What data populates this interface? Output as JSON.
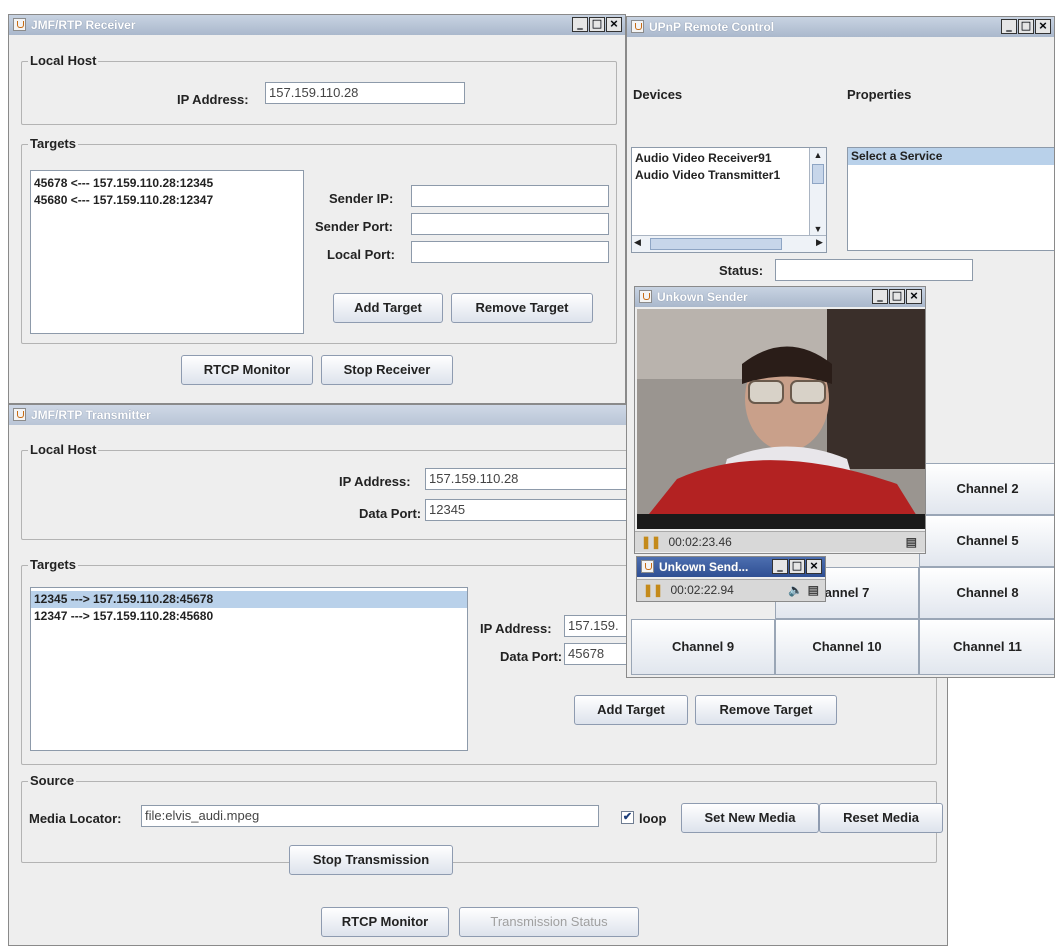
{
  "receiver": {
    "title": "JMF/RTP Receiver",
    "local_host_label": "Local Host",
    "ip_label": "IP Address:",
    "ip_value": "157.159.110.28",
    "targets_label": "Targets",
    "targets": [
      "45678 <--- 157.159.110.28:12345",
      "45680 <--- 157.159.110.28:12347"
    ],
    "sender_ip_label": "Sender IP:",
    "sender_port_label": "Sender Port:",
    "local_port_label": "Local Port:",
    "add_target": "Add Target",
    "remove_target": "Remove Target",
    "rtcp_monitor": "RTCP Monitor",
    "stop_receiver": "Stop Receiver"
  },
  "transmitter": {
    "title": "JMF/RTP Transmitter",
    "local_host_label": "Local Host",
    "ip_label": "IP Address:",
    "ip_value": "157.159.110.28",
    "data_port_label": "Data Port:",
    "data_port_value": "12345",
    "targets_label": "Targets",
    "targets": [
      "12345 ---> 157.159.110.28:45678",
      "12347 ---> 157.159.110.28:45680"
    ],
    "target_ip_label": "IP Address:",
    "target_ip_value": "157.159.",
    "target_port_label": "Data Port:",
    "target_port_value": "45678",
    "add_target": "Add Target",
    "remove_target": "Remove Target",
    "source_label": "Source",
    "media_locator_label": "Media Locator:",
    "media_locator_value": "file:elvis_audi.mpeg",
    "loop_label": "loop",
    "loop_checked": true,
    "set_new_media": "Set New Media",
    "reset_media": "Reset Media",
    "stop_transmission": "Stop Transmission",
    "rtcp_monitor": "RTCP Monitor",
    "transmission_status": "Transmission Status"
  },
  "upnp": {
    "title": "UPnP Remote Control",
    "devices_label": "Devices",
    "properties_label": "Properties",
    "devices": [
      "Audio Video Receiver91",
      "Audio Video Transmitter1"
    ],
    "service_placeholder": "Select a Service",
    "status_label": "Status:",
    "channels": [
      "Channel 2",
      "Channel 5",
      "annel 7",
      "Channel 8",
      "Channel 9",
      "Channel 10",
      "Channel 11"
    ]
  },
  "player1": {
    "title": "Unkown Sender",
    "time": "00:02:23.46"
  },
  "player2": {
    "title": "Unkown Send...",
    "time": "00:02:22.94"
  },
  "window_buttons": {
    "minimize": "_",
    "maximize": "□",
    "close": "×"
  },
  "icons": [
    "java-icon",
    "pause-icon",
    "volume-icon",
    "film-icon",
    "scroll-up-icon",
    "scroll-down-icon",
    "scroll-left-icon",
    "scroll-right-icon",
    "checkmark-icon"
  ]
}
